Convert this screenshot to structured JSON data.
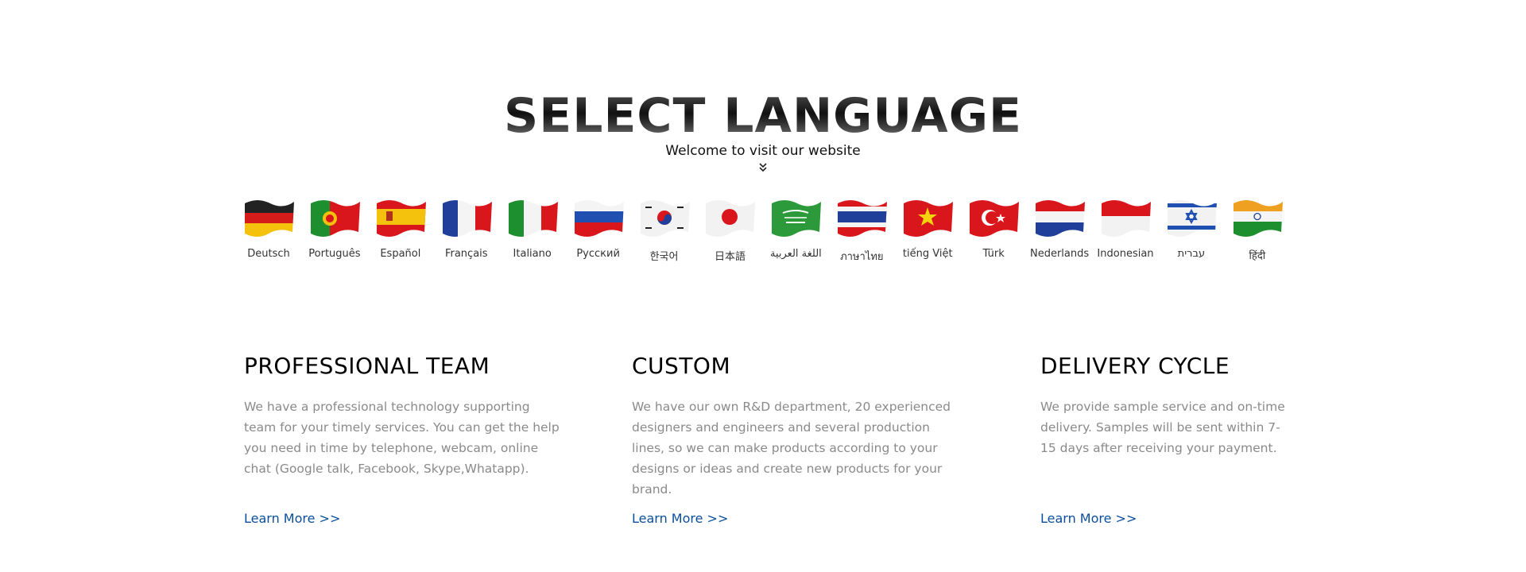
{
  "header": {
    "title": "SELECT LANGUAGE",
    "subtitle": "Welcome to visit our website",
    "chevron_icon": "double-chevron-down-icon"
  },
  "languages": [
    {
      "label": "Deutsch",
      "flag": "germany-flag-icon"
    },
    {
      "label": "Português",
      "flag": "portugal-flag-icon"
    },
    {
      "label": "Español",
      "flag": "spain-flag-icon"
    },
    {
      "label": "Français",
      "flag": "france-flag-icon"
    },
    {
      "label": "Italiano",
      "flag": "italy-flag-icon"
    },
    {
      "label": "Русский",
      "flag": "russia-flag-icon"
    },
    {
      "label": "한국어",
      "flag": "korea-flag-icon"
    },
    {
      "label": "日本語",
      "flag": "japan-flag-icon"
    },
    {
      "label": "اللغة العربية",
      "flag": "saudi-arabia-flag-icon"
    },
    {
      "label": "ภาษาไทย",
      "flag": "thailand-flag-icon"
    },
    {
      "label": "tiếng Việt",
      "flag": "vietnam-flag-icon"
    },
    {
      "label": "Türk",
      "flag": "turkey-flag-icon"
    },
    {
      "label": "Nederlands",
      "flag": "netherlands-flag-icon"
    },
    {
      "label": "Indonesian",
      "flag": "indonesia-flag-icon"
    },
    {
      "label": "עברית",
      "flag": "israel-flag-icon"
    },
    {
      "label": "हिंदी",
      "flag": "india-flag-icon"
    }
  ],
  "features": [
    {
      "title": "PROFESSIONAL TEAM",
      "text": "We have a professional technology supporting team for your timely services. You can get the help you need in time by telephone, webcam, online chat (Google talk, Facebook, Skype,Whatapp).",
      "link": "Learn More >>"
    },
    {
      "title": "CUSTOM",
      "text": "We have our own R&D department, 20 experienced designers and engineers and several production lines, so we can make products according to your designs or ideas and create new products for your brand.",
      "link": "Learn More >>"
    },
    {
      "title": "DELIVERY CYCLE",
      "text": "We provide sample service and on-time delivery. Samples will be sent within 7-15 days after receiving your payment.",
      "link": "Learn More >>"
    }
  ],
  "colors": {
    "link": "#0b4f9c",
    "body_text": "#8a8a8a",
    "heading": "#000000"
  }
}
